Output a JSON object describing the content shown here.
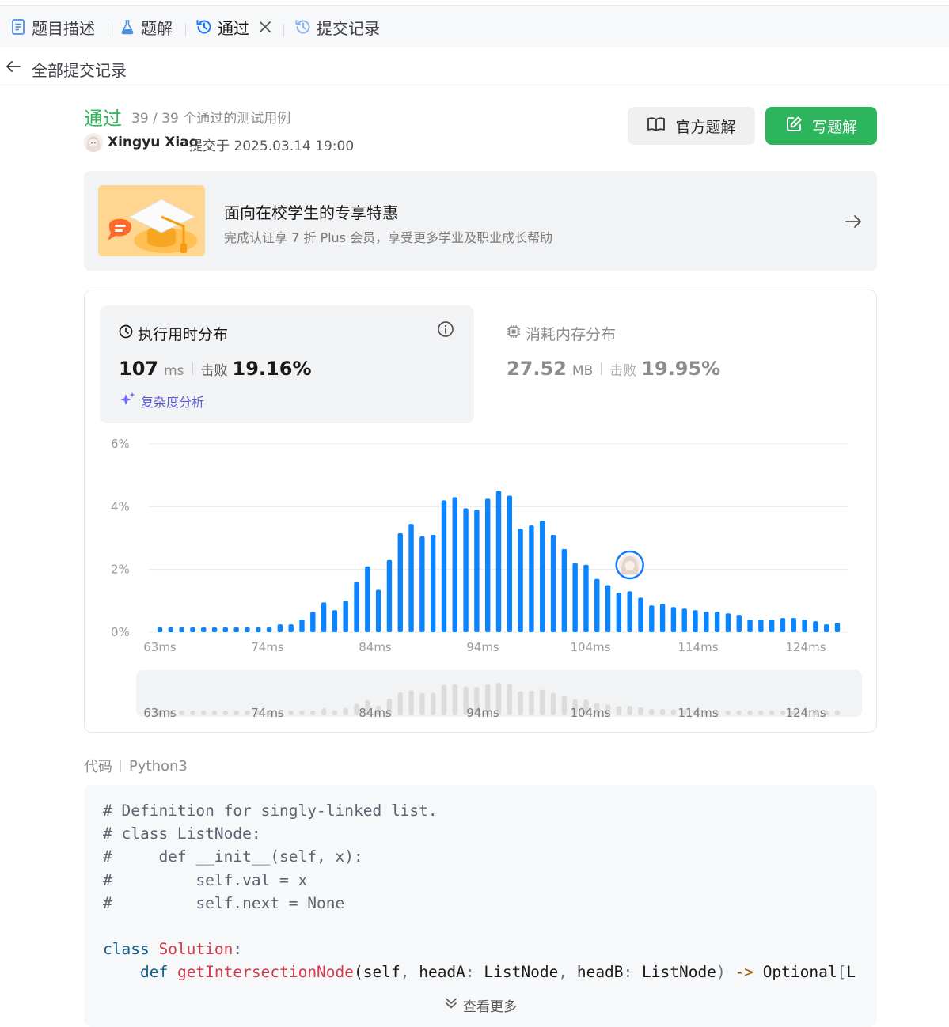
{
  "tabs": [
    {
      "label": "题目描述",
      "icon": "document-icon"
    },
    {
      "label": "题解",
      "icon": "flask-icon"
    },
    {
      "label": "通过",
      "icon": "history-icon",
      "active": true,
      "closable": true
    },
    {
      "label": "提交记录",
      "icon": "history-icon"
    }
  ],
  "back": {
    "label": "全部提交记录"
  },
  "submission": {
    "status": "通过",
    "cases": "39 / 39 个通过的测试用例",
    "user": "Xingyu Xiao",
    "submitted": "提交于 2025.03.14 19:00"
  },
  "buttons": {
    "official": "官方题解",
    "write": "写题解"
  },
  "promo": {
    "title": "面向在校学生的专享特惠",
    "subtitle": "完成认证享 7 折 Plus 会员，享受更多学业及职业成长帮助"
  },
  "runtime": {
    "title": "执行用时分布",
    "value": "107",
    "unit": "ms",
    "beat_label": "击败",
    "beat": "19.16%",
    "analysis": "复杂度分析"
  },
  "memory": {
    "title": "消耗内存分布",
    "value": "27.52",
    "unit": "MB",
    "beat_label": "击败",
    "beat": "19.95%"
  },
  "chart_data": {
    "type": "bar",
    "y_ticks": [
      "6%",
      "4%",
      "2%",
      "0%"
    ],
    "ylim": [
      0,
      6
    ],
    "x_ticks": [
      "63ms",
      "74ms",
      "84ms",
      "94ms",
      "104ms",
      "114ms",
      "124ms"
    ],
    "values": [
      0.15,
      0.15,
      0.15,
      0.15,
      0.15,
      0.15,
      0.15,
      0.15,
      0.15,
      0.15,
      0.15,
      0.25,
      0.25,
      0.4,
      0.65,
      0.95,
      0.7,
      1.0,
      1.6,
      2.1,
      1.35,
      2.3,
      3.15,
      3.45,
      3.05,
      3.1,
      4.2,
      4.3,
      3.95,
      3.9,
      4.25,
      4.5,
      4.35,
      3.3,
      3.4,
      3.55,
      3.1,
      2.65,
      2.2,
      2.15,
      1.7,
      1.5,
      1.25,
      1.3,
      1.1,
      0.85,
      0.9,
      0.8,
      0.75,
      0.7,
      0.65,
      0.65,
      0.6,
      0.55,
      0.4,
      0.4,
      0.4,
      0.45,
      0.45,
      0.4,
      0.35,
      0.25,
      0.3
    ],
    "highlight_index": 43,
    "color": "#0a84ff"
  },
  "code": {
    "language_label": "代码",
    "language": "Python3",
    "more": "查看更多"
  }
}
